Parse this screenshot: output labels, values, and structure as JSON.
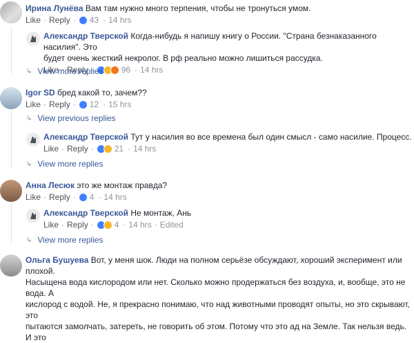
{
  "comments": [
    {
      "author": "Ирина Лунёва",
      "text": "Вам там нужно много терпения, чтобы не тронуться умом.",
      "like": "Like",
      "reply": "Reply",
      "reactions": "43",
      "time": "14 hrs"
    },
    {
      "author": "Александр Тверской",
      "text_line1": "Когда-нибудь я напишу книгу о России. \"Страна безнаказанного насилия\". Это",
      "text_line2": "будет очень жесткий некролог. В рф реально можно лишиться рассудка.",
      "like": "Like",
      "reply": "Reply",
      "reactions": "96",
      "time": "14 hrs"
    },
    {
      "view_more": "View more replies"
    },
    {
      "author": "Igor SD",
      "text": "бред какой то, зачем??",
      "like": "Like",
      "reply": "Reply",
      "reactions": "12",
      "time": "15 hrs"
    },
    {
      "view_previous": "View previous replies"
    },
    {
      "author": "Александр Тверской",
      "text": "Тут у насилия во все времена был один смысл - само насилие. Процесс.",
      "like": "Like",
      "reply": "Reply",
      "reactions": "21",
      "time": "14 hrs"
    },
    {
      "view_more": "View more replies"
    },
    {
      "author": "Анна Лесюк",
      "text": "это же монтаж правда?",
      "like": "Like",
      "reply": "Reply",
      "reactions": "4",
      "time": "14 hrs"
    },
    {
      "author": "Александр Тверской",
      "text": "Не монтаж, Ань",
      "like": "Like",
      "reply": "Reply",
      "reactions": "4",
      "time": "14 hrs",
      "edited": "Edited"
    },
    {
      "view_more": "View more replies"
    },
    {
      "author": "Ольга Бушуева",
      "text_line1": "Вот, у меня шок. Люди на полном серьёзе обсуждают, хороший эксперимент или плохой.",
      "text_line2": "Насыщена вода кислородом или нет. Сколько можно продержаться без воздуха, и, вообще, это не вода. А",
      "text_line3": "кислород с водой. Не, я прекрасно понимаю, что над животными проводят опыты, но это скрывают, это",
      "text_line4": "пытаются замолчать, затереть, не говорить об этом. Потому что это ад на Земле. Так нельзя ведь. И это"
    }
  ],
  "colors": {
    "name": "#385898",
    "meta": "#90949c",
    "like_reaction": "#4080ff",
    "haha_reaction": "#f7b928"
  }
}
